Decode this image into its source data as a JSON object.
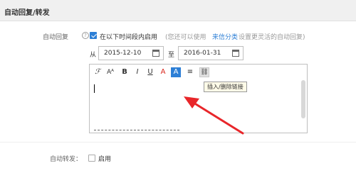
{
  "section": {
    "title": "自动回复/转发"
  },
  "auto_reply": {
    "label": "自动回复",
    "help_glyph": "?",
    "enable_label": "在以下时间段内启用",
    "hint_prefix": "(您还可以使用",
    "hint_link": "来信分类",
    "hint_suffix": "设置更灵活的自动回复)",
    "from_label": "从",
    "to_label": "至",
    "start_date": "2015-12-10",
    "end_date": "2016-01-31"
  },
  "toolbar": {
    "font": "ℱ",
    "font_size": "Aᴬ",
    "bold": "B",
    "italic": "I",
    "underline": "U",
    "font_color": "A",
    "bg_color": "A",
    "align": "≡",
    "link": "⛓"
  },
  "tooltip": "插入/删除链接",
  "auto_forward": {
    "label": "自动转发：",
    "enable_label": "启用"
  },
  "colors": {
    "accent": "#2d7fd6",
    "arrow": "#e8262a",
    "font_color_icon": "#d9261c",
    "bg_color_icon": "#2d7fd6"
  }
}
